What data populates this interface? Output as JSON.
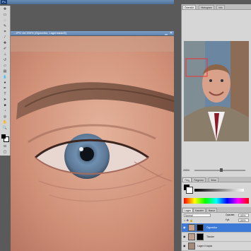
{
  "app": {
    "logo": "Ps"
  },
  "document": {
    "title": "...JPG vid 200% (Ögonvitor, Lagermask/8)",
    "minimize": "▁",
    "close": "✕"
  },
  "navigator": {
    "tabs": [
      "Översikt",
      "Histogram",
      "Info"
    ],
    "zoom": "200%"
  },
  "color_panel": {
    "tabs": [
      "Färg",
      "Färgrutor",
      "Stilar"
    ]
  },
  "layers_panel": {
    "tabs": [
      "Lager",
      "Kanaler",
      "Banor"
    ],
    "blend_mode": "Normal",
    "opacity_label": "Opacitet:",
    "opacity": "100%",
    "fill_label": "Fyll:",
    "fill": "100%",
    "layers": [
      {
        "name": "Ögonvitor",
        "selected": true
      },
      {
        "name": "Tänder",
        "selected": false
      },
      {
        "name": "Lager 0 kopia",
        "selected": false
      }
    ]
  },
  "colors": {
    "selection": "#3d7ad8",
    "panel_bg": "#d6d6d6",
    "title_bar": "#6c8fb8"
  }
}
